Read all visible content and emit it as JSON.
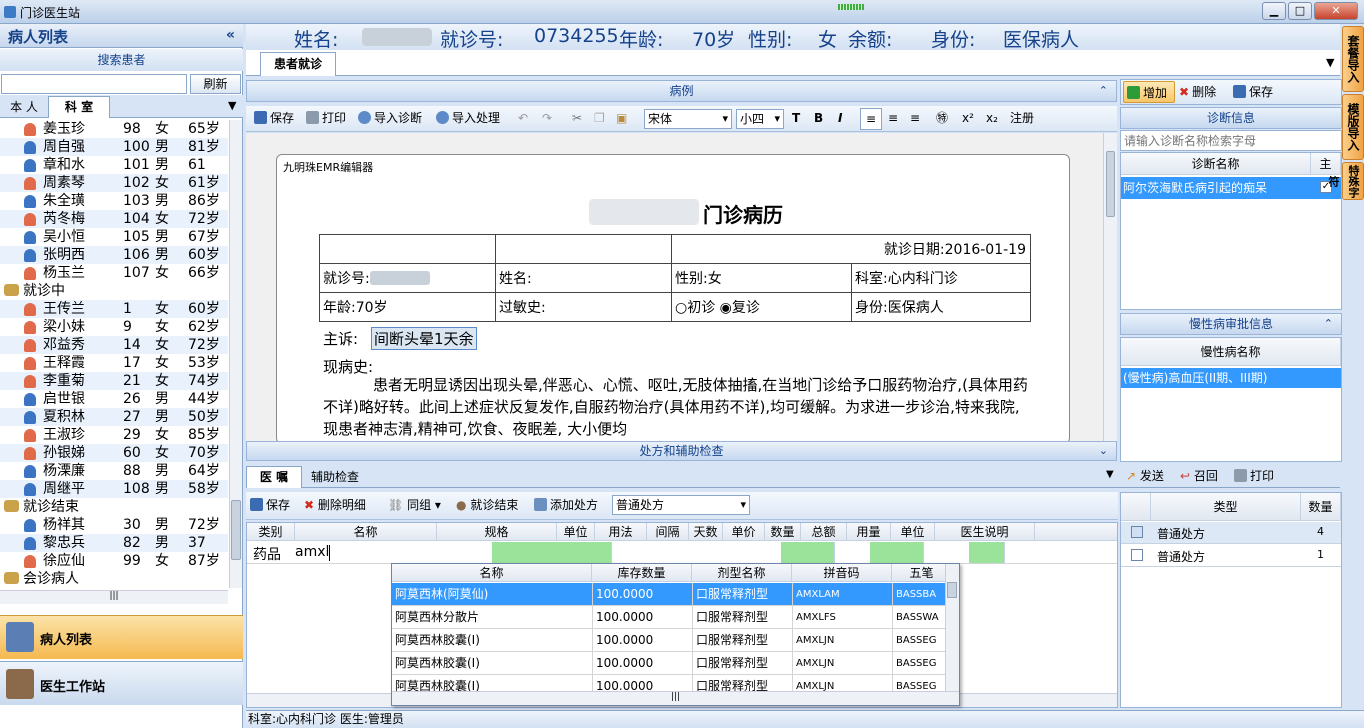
{
  "window": {
    "title": "门诊医生站",
    "min": "▁",
    "max": "□",
    "close": "✕"
  },
  "left": {
    "title": "病人列表",
    "collapse": "«",
    "search_label": "搜索患者",
    "search_placeholder": "",
    "refresh": "刷新",
    "tab_own": "本 人",
    "tab_dept": "科 室",
    "patients_top": [
      {
        "name": "姜玉珍",
        "no": "98",
        "sex": "女",
        "age": "65岁"
      },
      {
        "name": "周自强",
        "no": "100",
        "sex": "男",
        "age": "81岁"
      },
      {
        "name": "章和水",
        "no": "101",
        "sex": "男",
        "age": "61"
      },
      {
        "name": "周素琴",
        "no": "102",
        "sex": "女",
        "age": "61岁"
      },
      {
        "name": "朱全璜",
        "no": "103",
        "sex": "男",
        "age": "86岁"
      },
      {
        "name": "芮冬梅",
        "no": "104",
        "sex": "女",
        "age": "72岁"
      },
      {
        "name": "吴小恒",
        "no": "105",
        "sex": "男",
        "age": "67岁"
      },
      {
        "name": "张明西",
        "no": "106",
        "sex": "男",
        "age": "60岁"
      },
      {
        "name": "杨玉兰",
        "no": "107",
        "sex": "女",
        "age": "66岁"
      }
    ],
    "group_in": "就诊中",
    "patients_in": [
      {
        "name": "王传兰",
        "no": "1",
        "sex": "女",
        "age": "60岁"
      },
      {
        "name": "梁小妹",
        "no": "9",
        "sex": "女",
        "age": "62岁"
      },
      {
        "name": "邓益秀",
        "no": "14",
        "sex": "女",
        "age": "72岁"
      },
      {
        "name": "王释霞",
        "no": "17",
        "sex": "女",
        "age": "53岁"
      },
      {
        "name": "李重菊",
        "no": "21",
        "sex": "女",
        "age": "74岁"
      },
      {
        "name": "启世银",
        "no": "26",
        "sex": "男",
        "age": "44岁"
      },
      {
        "name": "夏积林",
        "no": "27",
        "sex": "男",
        "age": "50岁"
      },
      {
        "name": "王淑珍",
        "no": "29",
        "sex": "女",
        "age": "85岁"
      },
      {
        "name": "孙银娣",
        "no": "60",
        "sex": "女",
        "age": "70岁"
      },
      {
        "name": "杨溧廉",
        "no": "88",
        "sex": "男",
        "age": "64岁"
      },
      {
        "name": "周继平",
        "no": "108",
        "sex": "男",
        "age": "58岁"
      }
    ],
    "group_done": "就诊结束",
    "patients_done": [
      {
        "name": "杨祥其",
        "no": "30",
        "sex": "男",
        "age": "72岁"
      },
      {
        "name": "黎忠兵",
        "no": "82",
        "sex": "男",
        "age": "37"
      },
      {
        "name": "徐应仙",
        "no": "99",
        "sex": "女",
        "age": "87岁"
      }
    ],
    "group_consult": "会诊病人",
    "nav_patients": "病人列表",
    "nav_workstation": "医生工作站"
  },
  "header": {
    "name_label": "姓名:",
    "visit_label": "就诊号:",
    "visit_no": "0734255",
    "age_label": "年龄:",
    "age": "70岁",
    "sex_label": "性别:",
    "sex": "女",
    "balance_label": "余额:",
    "identity_label": "身份:",
    "identity": "医保病人"
  },
  "tabs": {
    "active": "患者就诊"
  },
  "emr": {
    "title": "病例",
    "toolbar": {
      "save": "保存",
      "print": "打印",
      "import_diag": "导入诊断",
      "import_treat": "导入处理",
      "font": "宋体",
      "size": "小四",
      "register": "注册",
      "sup": "x²",
      "sub": "x₂"
    },
    "editor_name": "九明珠EMR编辑器",
    "doc_title": "门诊病历",
    "date_label": "就诊日期:",
    "date": "2016-01-19",
    "visit_label": "就诊号:",
    "name_label": "姓名:",
    "sex_label": "性别:女",
    "dept_label": "科室:心内科门诊",
    "age_label": "年龄:70岁",
    "allergy_label": "过敏史:",
    "first": "初诊",
    "revisit": "复诊",
    "identity_label": "身份:医保病人",
    "complaint_label": "主诉:",
    "complaint": "间断头晕1天余",
    "hpi_label": "现病史:",
    "hpi": "患者无明显诱因出现头晕,伴恶心、心慌、呕吐,无肢体抽搐,在当地门诊给予口服药物治疗,(具体用药不详)略好转。此间上述症状反复发作,自服药物治疗(具体用药不详),均可缓解。为求进一步诊治,特来我院,现患者神志清,精神可,饮食、夜眠差, 大小便均"
  },
  "diagnosis": {
    "add": "增加",
    "delete": "删除",
    "save": "保存",
    "title": "诊断信息",
    "search_placeholder": "请输入诊断名称检索字母",
    "col_name": "诊断名称",
    "col_main": "主",
    "items": [
      {
        "name": "阿尔茨海默氏病引起的痴呆",
        "main": "✓"
      }
    ]
  },
  "chronic": {
    "title": "慢性病审批信息",
    "col_name": "慢性病名称",
    "items": [
      "(慢性病)高血压(II期、III期)"
    ]
  },
  "presc_bar": {
    "title": "处方和辅助检查"
  },
  "orders": {
    "tab_active": "医 嘱",
    "tab_other": "辅助检查",
    "send": "发送",
    "recall": "召回",
    "print": "打印",
    "toolbar": {
      "save": "保存",
      "del_detail": "删除明细",
      "group": "同组",
      "end_visit": "就诊结束",
      "add_presc": "添加处方",
      "presc_type": "普通处方"
    },
    "columns": [
      "类别",
      "名称",
      "规格",
      "单位",
      "用法",
      "间隔",
      "天数",
      "单价",
      "数量",
      "总额",
      "用量",
      "单位",
      "医生说明"
    ],
    "row": {
      "category": "药品",
      "name": "amxl"
    }
  },
  "drug_popup": {
    "columns": [
      "名称",
      "库存数量",
      "剂型名称",
      "拼音码",
      "五笔"
    ],
    "rows": [
      {
        "name": "阿莫西林(阿莫仙)",
        "stock": "100.0000",
        "form": "口服常释剂型",
        "py": "AMXLAM",
        "wb": "BASSBA"
      },
      {
        "name": "阿莫西林分散片",
        "stock": "100.0000",
        "form": "口服常释剂型",
        "py": "AMXLFS",
        "wb": "BASSWA"
      },
      {
        "name": "阿莫西林胶囊(I)",
        "stock": "100.0000",
        "form": "口服常释剂型",
        "py": "AMXLJN",
        "wb": "BASSEG"
      },
      {
        "name": "阿莫西林胶囊(I)",
        "stock": "100.0000",
        "form": "口服常释剂型",
        "py": "AMXLJN",
        "wb": "BASSEG"
      },
      {
        "name": "阿莫西林胶囊(I)",
        "stock": "100.0000",
        "form": "口服常释剂型",
        "py": "AMXLJN",
        "wb": "BASSEG"
      }
    ]
  },
  "presc_list": {
    "col_type": "类型",
    "col_qty": "数量",
    "items": [
      {
        "type": "普通处方",
        "qty": "4"
      },
      {
        "type": "普通处方",
        "qty": "1"
      }
    ]
  },
  "vtabs": [
    "套餐导入",
    "模版导入",
    "特殊字符"
  ],
  "status": {
    "text": "科室:心内科门诊  医生:管理员"
  },
  "colors": {
    "accent": "#15428b",
    "selected": "#3399ff",
    "nav_active": "#f5b94f",
    "vtab": "#f0a143"
  }
}
